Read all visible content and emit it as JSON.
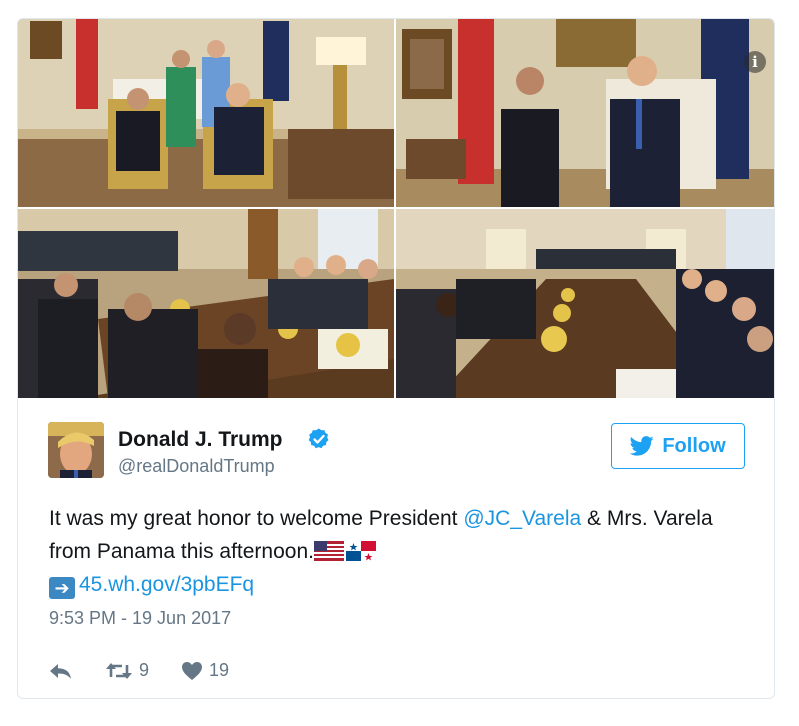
{
  "tweet": {
    "display_name": "Donald J. Trump",
    "handle": "@realDonaldTrump",
    "follow_label": "Follow",
    "text_before_mention": "It was my great honor to welcome President ",
    "mention": "@JC_Varela",
    "text_after_mention": " & Mrs. Varela from Panama this afternoon.",
    "link": "45.wh.gov/3pbEFq",
    "timestamp": "9:53 PM - 19 Jun 2017",
    "retweet_count": "9",
    "like_count": "19"
  },
  "icons": {
    "verified": "verified-badge-icon",
    "bird": "twitter-bird-icon",
    "reply": "reply-icon",
    "retweet": "retweet-icon",
    "like": "heart-icon",
    "info": "info-icon",
    "info_glyph": "i"
  },
  "colors": {
    "accent": "#1da1f2",
    "link": "#1b95e0",
    "muted": "#657786"
  }
}
